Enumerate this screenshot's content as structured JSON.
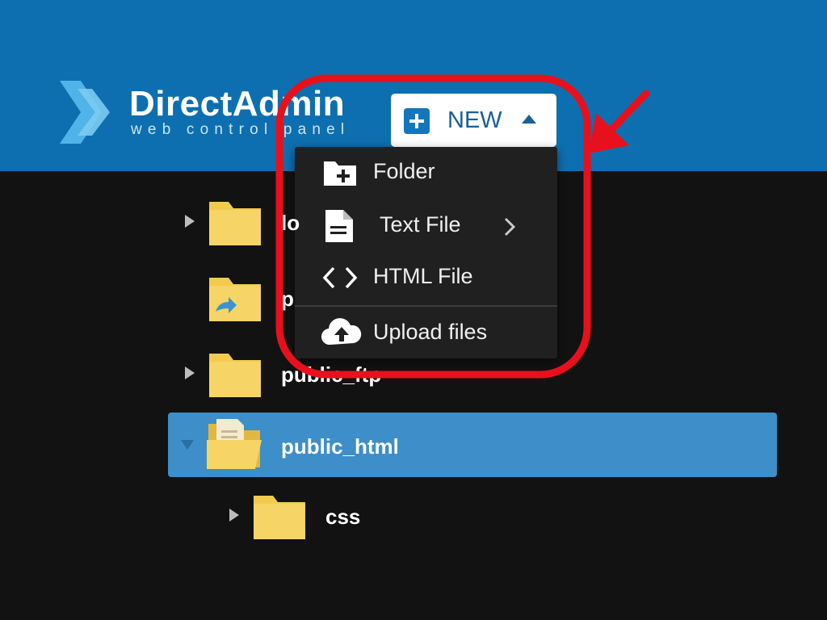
{
  "header": {
    "logo_title": "DirectAdmin",
    "logo_subtitle": "web control panel",
    "new_button_label": "NEW"
  },
  "dropdown": {
    "items": [
      {
        "label": "Folder",
        "icon": "folder-plus-icon"
      },
      {
        "label": "Text File",
        "icon": "document-icon",
        "has_submenu": true
      },
      {
        "label": "HTML File",
        "icon": "code-icon"
      },
      {
        "label": "Upload files",
        "icon": "cloud-upload-icon"
      }
    ]
  },
  "tree": {
    "rows": [
      {
        "label": "lo",
        "expandable": true
      },
      {
        "label": "p",
        "icon": "shortcut-folder-icon"
      },
      {
        "label": "public_ftp",
        "expandable": true
      },
      {
        "label": "public_html",
        "expanded": true,
        "selected": true
      },
      {
        "label": "css",
        "expandable": true
      }
    ]
  },
  "colors": {
    "header_bg": "#0d6fb0",
    "page_bg": "#121212",
    "selected_row": "#3d8ec9",
    "folder": "#f2cb4e",
    "annotation": "#e8101c"
  }
}
